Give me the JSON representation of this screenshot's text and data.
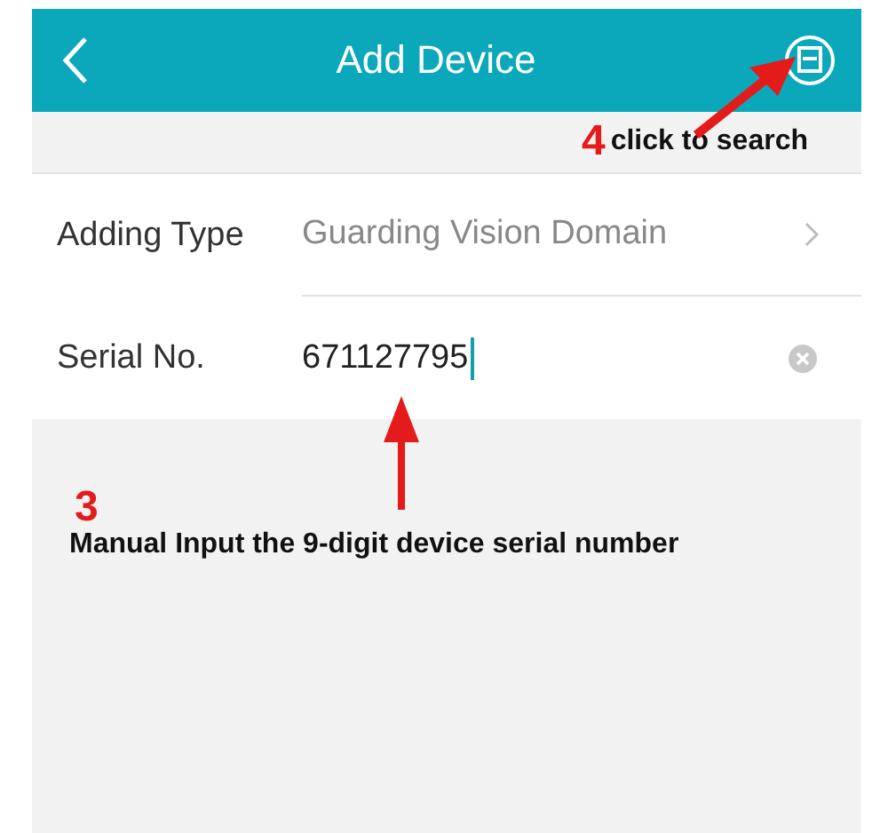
{
  "header": {
    "title": "Add Device"
  },
  "hint": {
    "step": "4",
    "text": "click to search"
  },
  "rows": [
    {
      "kind": "select",
      "label": "Adding Type",
      "value": "Guarding Vision Domain"
    },
    {
      "kind": "input",
      "label": "Serial No.",
      "value": "671127795"
    }
  ],
  "note": {
    "step": "3",
    "text": "Manual Input the 9-digit device serial number"
  }
}
